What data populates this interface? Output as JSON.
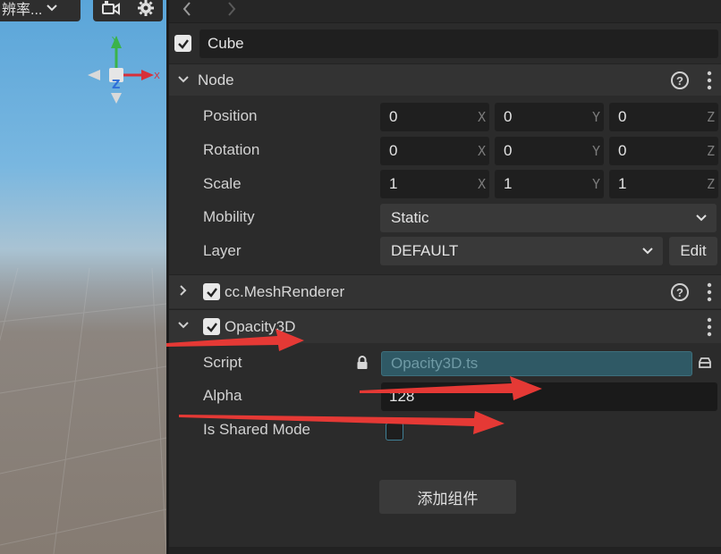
{
  "scene": {
    "resolution_label": "辨率...",
    "icons": [
      "chevron-down-icon",
      "camera-icon",
      "gear-icon"
    ],
    "gizmo_axes": {
      "y": "Y",
      "x": "X",
      "z": "Z"
    }
  },
  "inspector": {
    "node_name": "Cube",
    "node_section": {
      "title": "Node",
      "position": {
        "label": "Position",
        "x": "0",
        "y": "0",
        "z": "0"
      },
      "rotation": {
        "label": "Rotation",
        "x": "0",
        "y": "0",
        "z": "0"
      },
      "scale": {
        "label": "Scale",
        "x": "1",
        "y": "1",
        "z": "1"
      },
      "axis_labels": {
        "x": "X",
        "y": "Y",
        "z": "Z"
      },
      "mobility": {
        "label": "Mobility",
        "value": "Static"
      },
      "layer": {
        "label": "Layer",
        "value": "DEFAULT",
        "edit_label": "Edit"
      }
    },
    "mesh_renderer": {
      "title": "cc.MeshRenderer"
    },
    "opacity3d": {
      "title": "Opacity3D",
      "script": {
        "label": "Script",
        "value": "Opacity3D.ts"
      },
      "alpha": {
        "label": "Alpha",
        "value": "128"
      },
      "shared_mode": {
        "label": "Is Shared Mode",
        "checked": false
      }
    },
    "add_component_label": "添加组件"
  },
  "colors": {
    "panel_bg": "#2b2b2b",
    "section_bg": "#333333",
    "field_bg": "#1f1f1f",
    "script_field_bg": "#2f5965",
    "annotation_arrow": "#e53935",
    "gizmo_x": "#d8303a",
    "gizmo_y": "#3bb34a",
    "gizmo_z": "#2f6fd8"
  }
}
